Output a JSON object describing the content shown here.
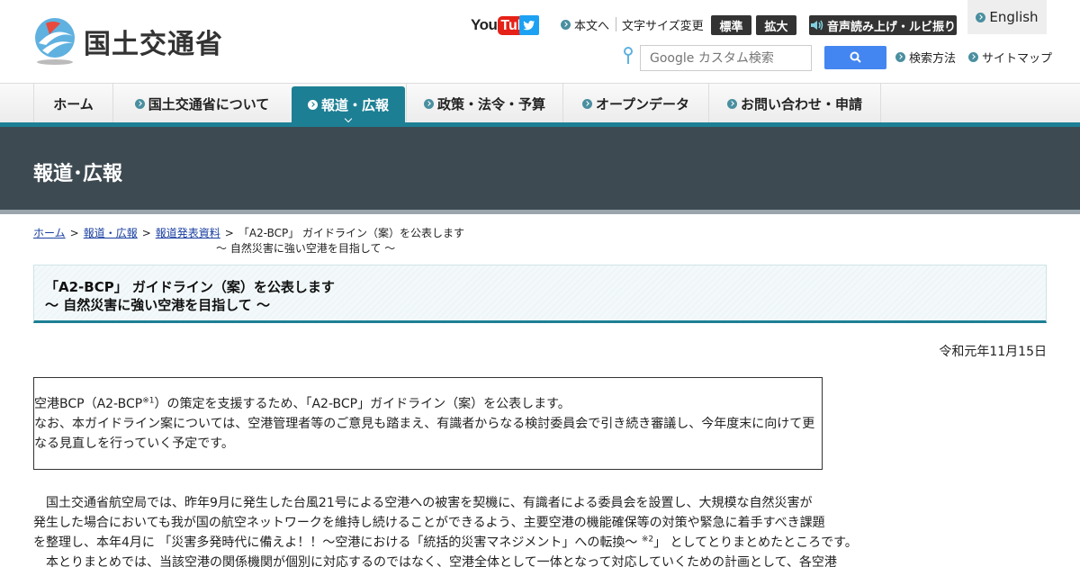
{
  "header": {
    "logo_text": "国土交通省",
    "youtube": {
      "you": "You",
      "tube": "Tube"
    },
    "skip_to_content": "本文へ",
    "font_size_label": "文字サイズ変更",
    "font_standard": "標準",
    "font_large": "拡大",
    "read_aloud": "音声読み上げ・ルビ振り",
    "english": "English",
    "search_placeholder": "Google カスタム検索",
    "search_method": "検索方法",
    "sitemap": "サイトマップ"
  },
  "nav": {
    "items": [
      {
        "label": "ホーム"
      },
      {
        "label": "国土交通省について"
      },
      {
        "label": "報道・広報"
      },
      {
        "label": "政策・法令・予算"
      },
      {
        "label": "オープンデータ"
      },
      {
        "label": "お問い合わせ・申請"
      }
    ]
  },
  "banner": {
    "title": "報道･広報"
  },
  "breadcrumb": {
    "home": "ホーム",
    "press": "報道・広報",
    "releases": "報道発表資料",
    "current_line1": "「A2-BCP」 ガイドライン（案）を公表します",
    "current_line2": "～ 自然災害に強い空港を目指して ～",
    "separator": ">"
  },
  "article": {
    "title_line1": "「A2-BCP」 ガイドライン（案）を公表します",
    "title_line2": "～ 自然災害に強い空港を目指して ～",
    "date": "令和元年11月15日",
    "summary": {
      "line1_a": "空港BCP（A2-BCP",
      "line1_sup": "※1",
      "line1_b": "）の策定を支援するため、「A2-BCP」ガイドライン（案）を公表します。",
      "line2": "なお、本ガイドライン案については、空港管理者等のご意見も踏まえ、有識者からなる検討委員会で引き続き審議し、今年度末に向けて更",
      "line3": "なる見直しを行っていく予定です。"
    },
    "body": {
      "line1": "　国土交通省航空局では、昨年9月に発生した台風21号による空港への被害を契機に、有識者による委員会を設置し、大規模な自然災害が",
      "line2": "発生した場合においても我が国の航空ネットワークを維持し続けることができるよう、主要空港の機能確保等の対策や緊急に着手すべき課題",
      "line3_a": "を整理し、本年4月に 「災害多発時代に備えよ！！～空港における「統括的災害マネジメント」への転換～ ",
      "line3_sup": "※2",
      "line3_b": "」 としてとりまとめたところです。",
      "line4": "　本とりまとめでは、当該空港の関係機関が個別に対応するのではなく、空港全体として一体となって対応していくための計画として、各空港"
    }
  },
  "colors": {
    "accent": "#1d7f94",
    "banner": "#3e4a52",
    "search_button": "#4486f1",
    "youtube_red": "#e62117",
    "twitter_blue": "#1da1f2"
  }
}
